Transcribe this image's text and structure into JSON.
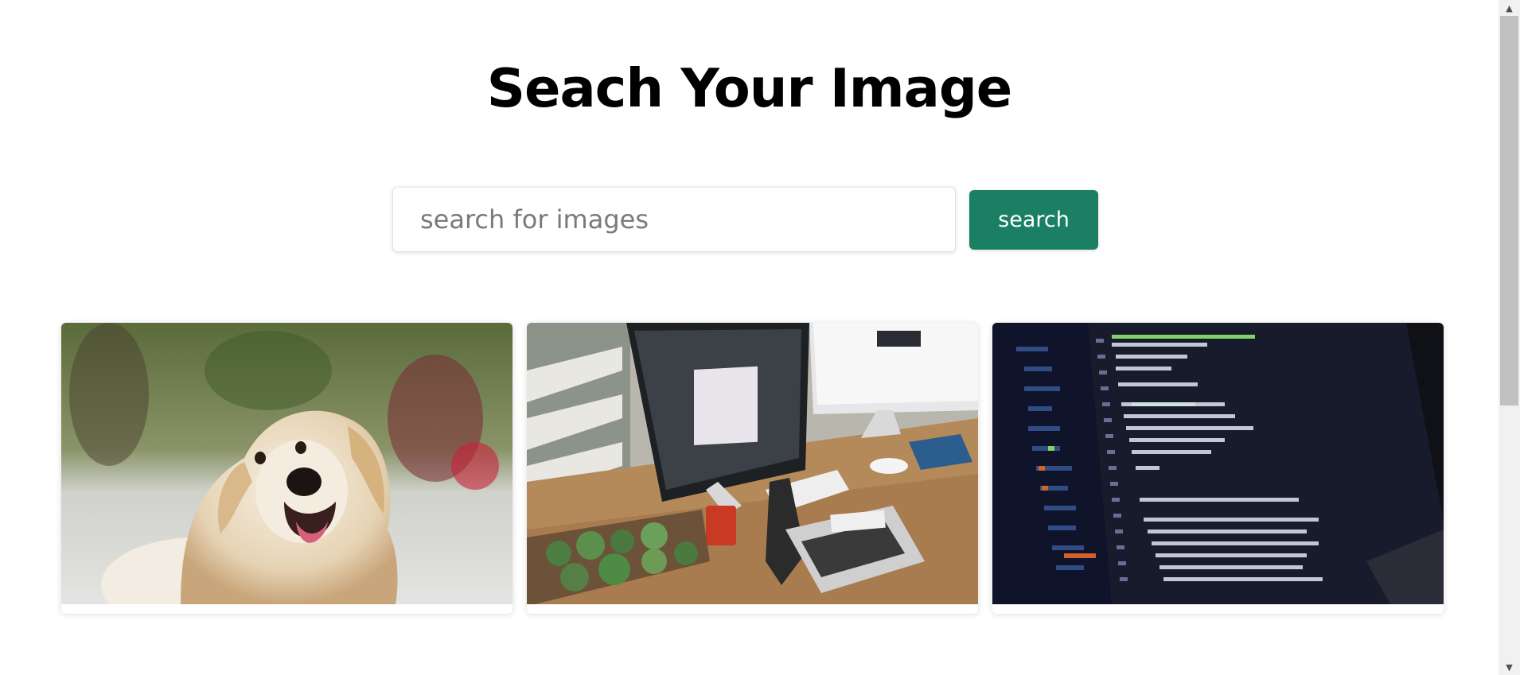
{
  "header": {
    "title": "Seach Your Image"
  },
  "search": {
    "placeholder": "search for images",
    "value": "",
    "button_label": "search",
    "button_color": "#1a7f63"
  },
  "results": {
    "images": [
      {
        "subject": "golden retriever dog"
      },
      {
        "subject": "desk with computer monitors, laptop and plants"
      },
      {
        "subject": "code editor on laptop screen"
      }
    ]
  },
  "scrollbar": {
    "up_icon": "triangle-up-icon",
    "down_icon": "triangle-down-icon"
  }
}
